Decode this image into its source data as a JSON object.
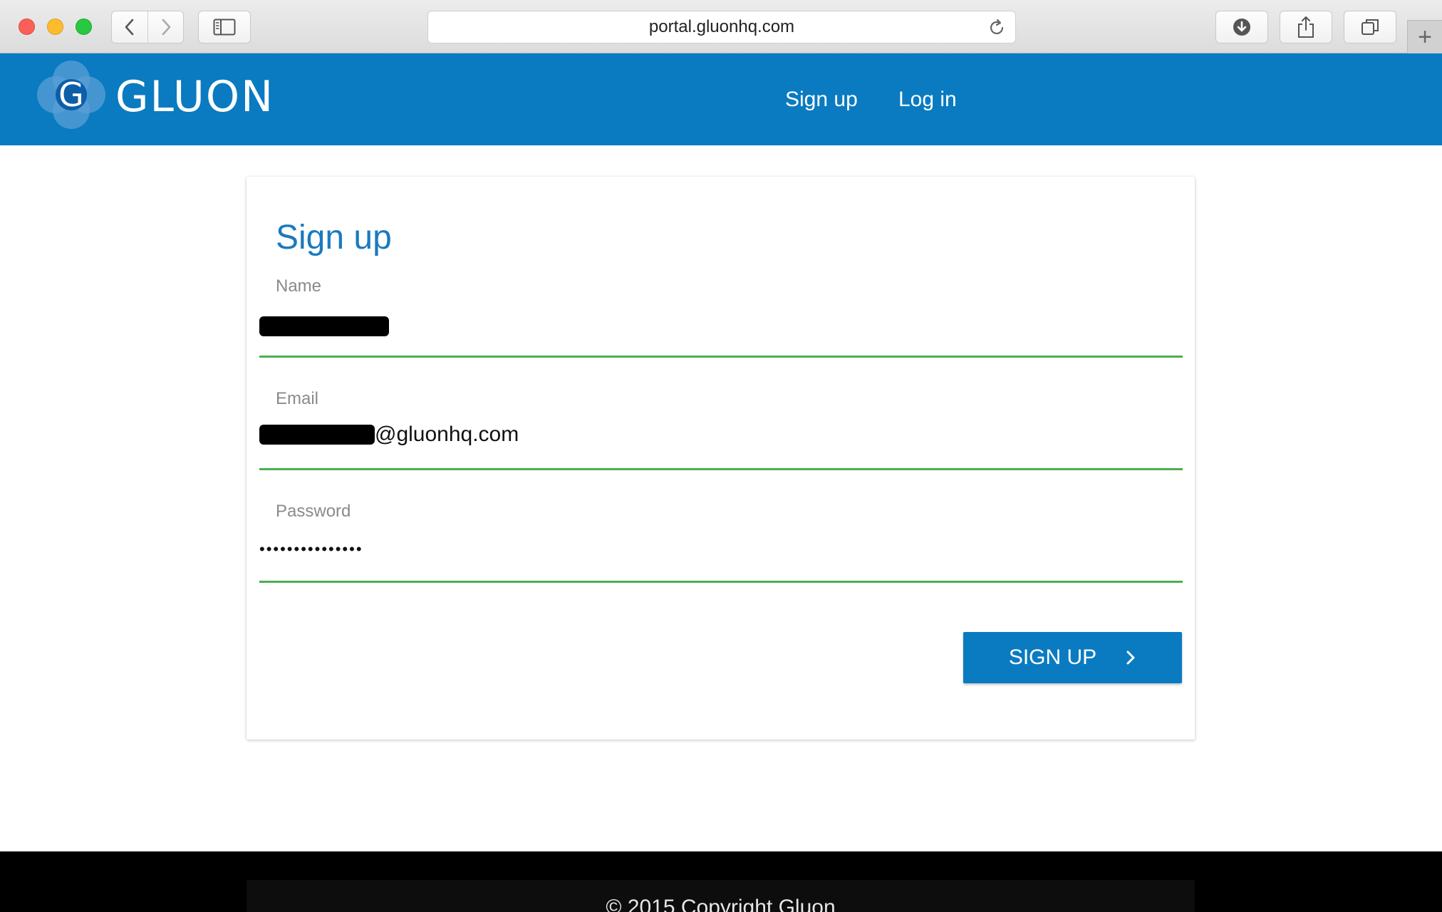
{
  "browser": {
    "url": "portal.gluonhq.com",
    "new_tab_symbol": "+"
  },
  "header": {
    "brand": "GLUON",
    "logo_letter": "G",
    "nav": {
      "signup": "Sign up",
      "login": "Log in"
    },
    "color": "#0a7bc0"
  },
  "form": {
    "title": "Sign up",
    "name": {
      "label": "Name",
      "value": "[redacted]"
    },
    "email": {
      "label": "Email",
      "value_suffix": "@gluonhq.com"
    },
    "password": {
      "label": "Password",
      "value": "•••••••••••••••"
    },
    "submit_label": "SIGN UP",
    "underline_color": "#4caf50"
  },
  "footer": {
    "copyright": "© 2015 Copyright Gluon"
  }
}
